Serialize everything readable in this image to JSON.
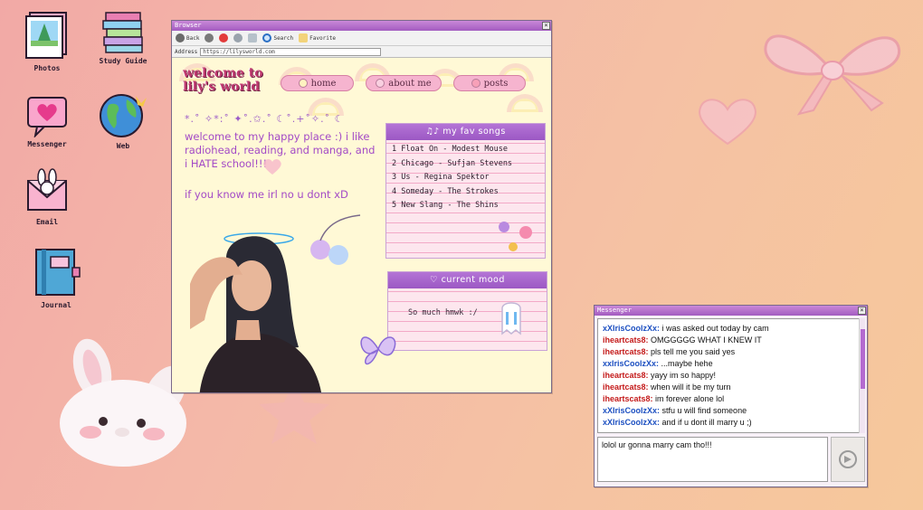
{
  "desktop": {
    "icons": [
      {
        "label": "Photos",
        "icon": "photos-icon"
      },
      {
        "label": "Study Guide",
        "icon": "books-icon"
      },
      {
        "label": "Messenger",
        "icon": "chat-heart-icon"
      },
      {
        "label": "Web",
        "icon": "globe-icon"
      },
      {
        "label": "Email",
        "icon": "envelope-bunny-icon"
      },
      {
        "label": "Journal",
        "icon": "journal-icon"
      }
    ]
  },
  "browser": {
    "title": "Browser",
    "toolbar": {
      "back": "Back",
      "search": "Search",
      "favorite": "Favorite"
    },
    "address_label": "Address",
    "address_value": "https://lilysworld.com",
    "site": {
      "title": "welcome to lily's world",
      "nav": [
        "home",
        "about me",
        "posts"
      ],
      "sparkles": "*.˚ ✧*:˚ ✦˚.✩.˚ ☾˚.+˚✧.˚ ☾",
      "intro": "welcome to my happy place :) i like radiohead, reading, and manga, and i HATE school!!!",
      "intro2": "if you know me irl no u dont xD",
      "songs_title": "♫♪ my fav songs",
      "songs": [
        "1 Float On - Modest Mouse",
        "2 Chicago - Sufjan Stevens",
        "3 Us - Regina Spektor",
        "4 Someday - The Strokes",
        "5 New Slang - The Shins"
      ],
      "mood_title": "♡ current mood",
      "mood_text": "So much hmwk :/"
    }
  },
  "messenger": {
    "title": "Messenger",
    "messages": [
      {
        "user": "xXIrisCoolzXx",
        "color": "blue",
        "text": "i was asked out today by cam"
      },
      {
        "user": "iheartcats8",
        "color": "red",
        "text": "OMGGGGG WHAT I KNEW IT"
      },
      {
        "user": "iheartcats8",
        "color": "red",
        "text": "pls tell me you said yes"
      },
      {
        "user": "xxIrisCoolzXx",
        "color": "blue",
        "text": "...maybe hehe"
      },
      {
        "user": "iheartcats8",
        "color": "red",
        "text": "yayy im so happy!"
      },
      {
        "user": "iheartcats8",
        "color": "red",
        "text": "when will it be my turn"
      },
      {
        "user": "iheartscats8",
        "color": "red",
        "text": "im forever alone lol"
      },
      {
        "user": "xXIrisCoolzXx",
        "color": "blue",
        "text": "stfu u will find someone"
      },
      {
        "user": "xXIrisCoolzXx",
        "color": "blue",
        "text": "and if u dont ill marry u ;)"
      }
    ],
    "input_value": "lolol ur gonna marry cam tho!!!"
  }
}
